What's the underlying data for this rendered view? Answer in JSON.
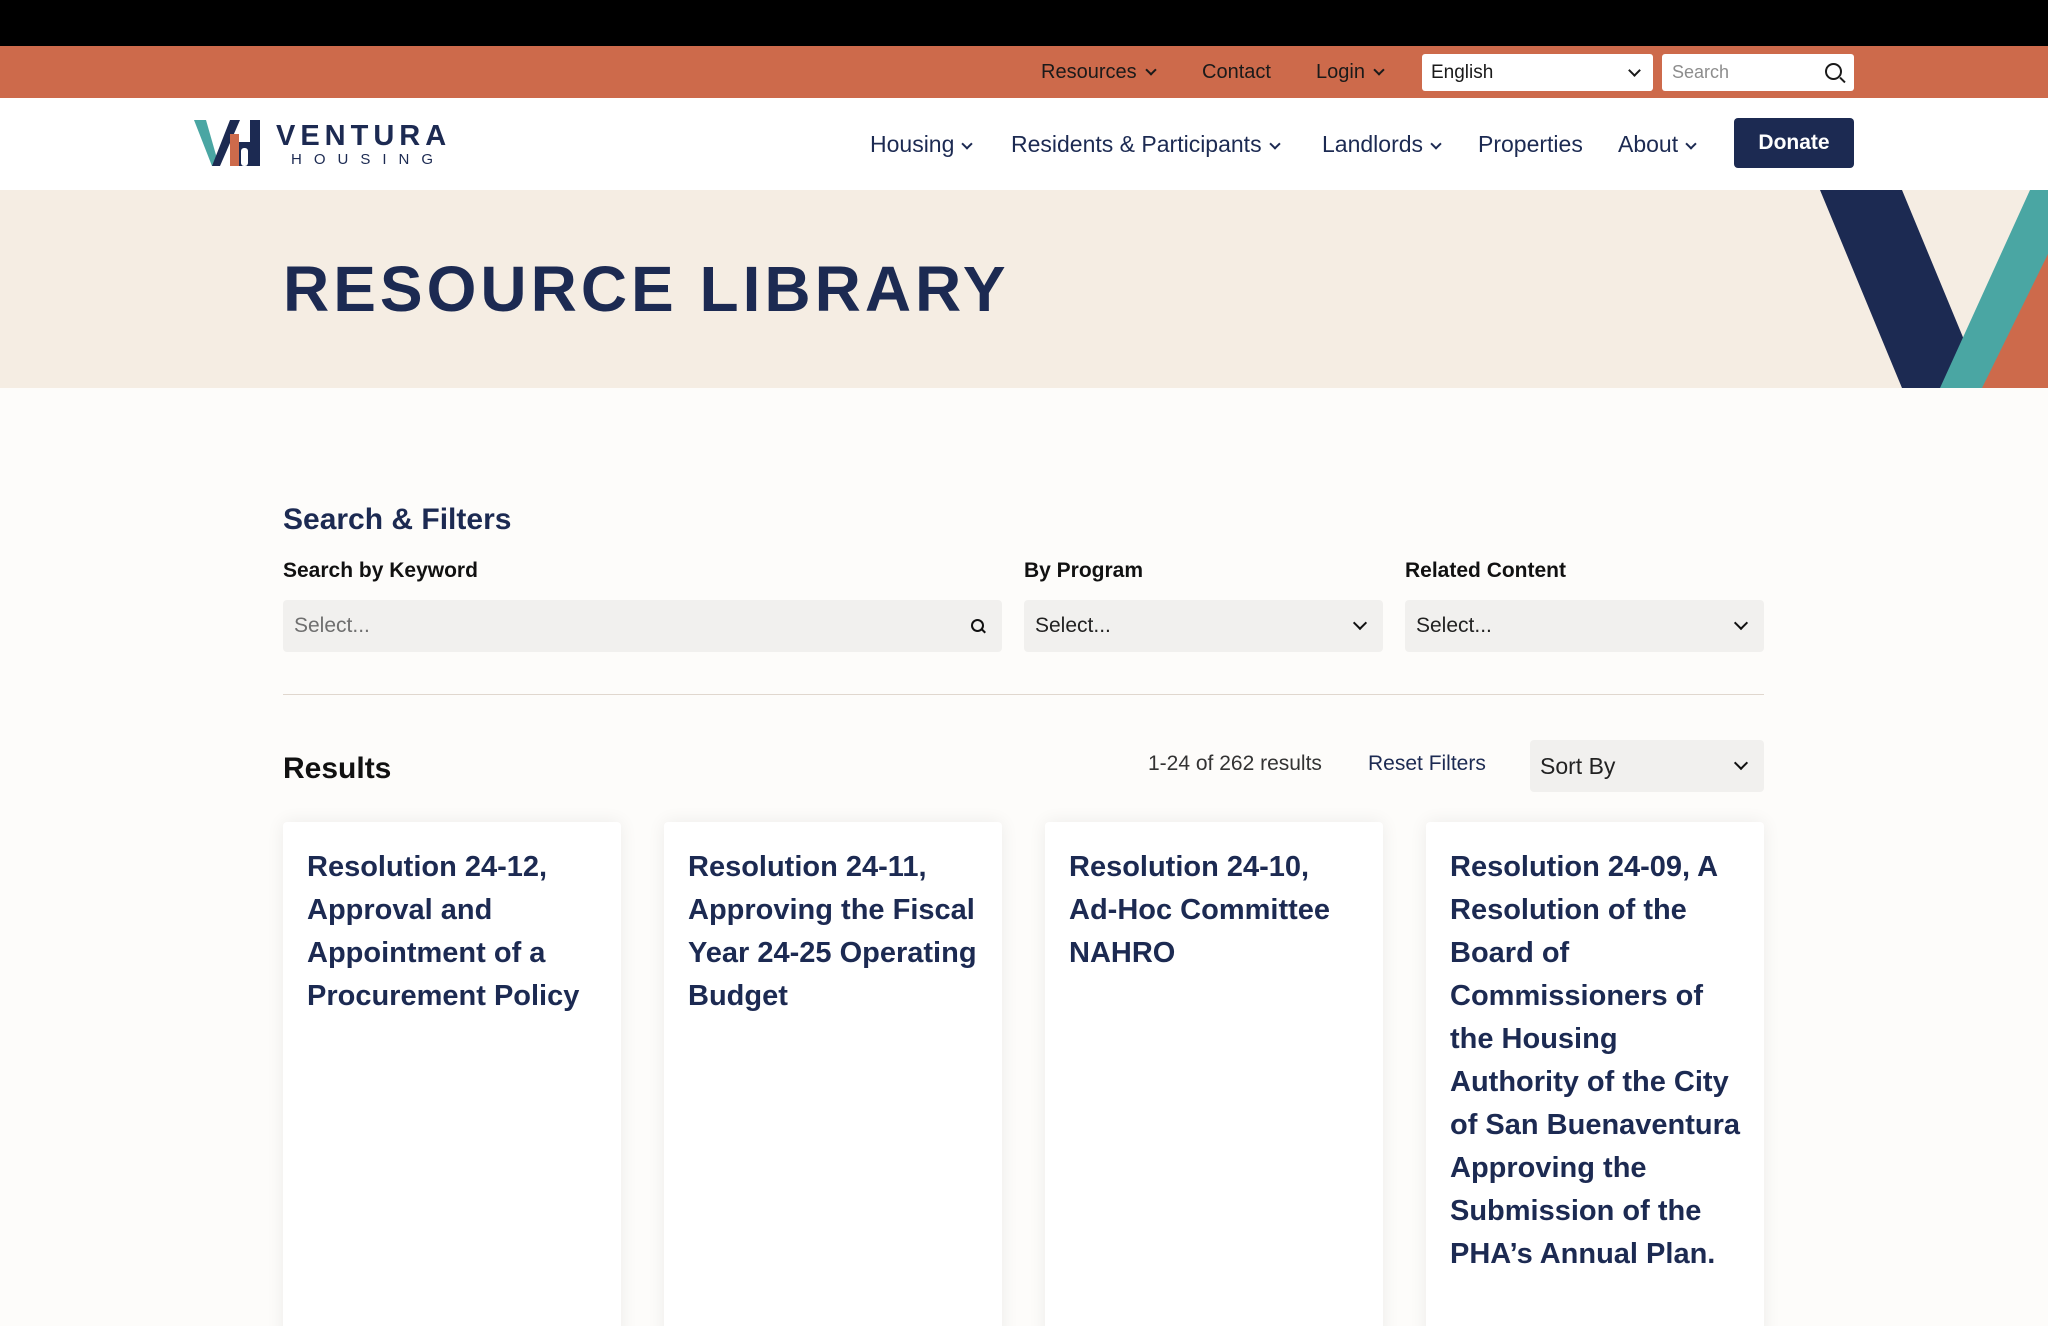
{
  "utility_nav": {
    "resources": "Resources",
    "contact": "Contact",
    "login": "Login",
    "language": "English",
    "search_placeholder": "Search"
  },
  "brand": {
    "name": "VENTURA",
    "sub": "HOUSING",
    "colors": {
      "navy": "#1c2a52",
      "teal": "#4aa6a3",
      "terracotta": "#cd6a4b"
    }
  },
  "main_nav": {
    "items": [
      "Housing",
      "Residents & Participants",
      "Landlords",
      "Properties",
      "About"
    ],
    "donate": "Donate"
  },
  "hero": {
    "title": "RESOURCE LIBRARY"
  },
  "filters": {
    "heading": "Search & Filters",
    "keyword_label": "Search by Keyword",
    "keyword_placeholder": "Select...",
    "program_label": "By Program",
    "program_value": "Select...",
    "related_label": "Related Content",
    "related_value": "Select..."
  },
  "results": {
    "heading": "Results",
    "count": "1-24 of 262 results",
    "reset": "Reset Filters",
    "sort": "Sort By"
  },
  "cards": [
    {
      "title": "Resolution 24-12, Approval and Appointment of a Procurement Policy"
    },
    {
      "title": "Resolution 24-11, Approving the Fiscal Year 24-25 Operating Budget"
    },
    {
      "title": "Resolution 24-10, Ad-Hoc Committee NAHRO"
    },
    {
      "title": "Resolution 24-09, A Resolution of the Board of Commissioners of the Housing Authority of the City of San Buenaventura Approving the Submission of the PHA’s Annual Plan."
    }
  ]
}
